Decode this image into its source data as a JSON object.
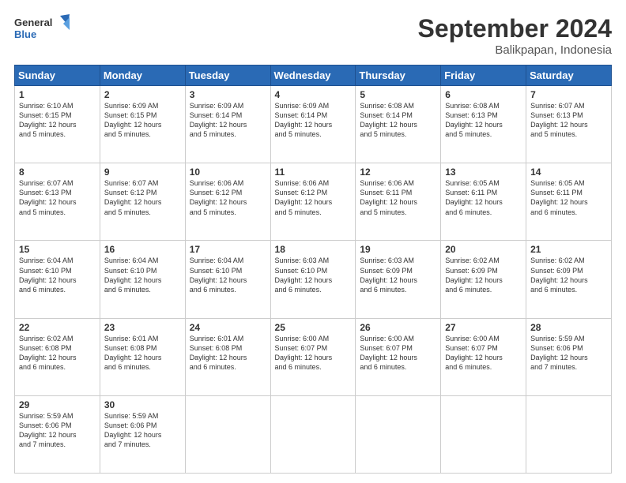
{
  "logo": {
    "line1": "General",
    "line2": "Blue"
  },
  "title": "September 2024",
  "subtitle": "Balikpapan, Indonesia",
  "days_of_week": [
    "Sunday",
    "Monday",
    "Tuesday",
    "Wednesday",
    "Thursday",
    "Friday",
    "Saturday"
  ],
  "weeks": [
    [
      {
        "date": "1",
        "info": "Sunrise: 6:10 AM\nSunset: 6:15 PM\nDaylight: 12 hours\nand 5 minutes."
      },
      {
        "date": "2",
        "info": "Sunrise: 6:09 AM\nSunset: 6:15 PM\nDaylight: 12 hours\nand 5 minutes."
      },
      {
        "date": "3",
        "info": "Sunrise: 6:09 AM\nSunset: 6:14 PM\nDaylight: 12 hours\nand 5 minutes."
      },
      {
        "date": "4",
        "info": "Sunrise: 6:09 AM\nSunset: 6:14 PM\nDaylight: 12 hours\nand 5 minutes."
      },
      {
        "date": "5",
        "info": "Sunrise: 6:08 AM\nSunset: 6:14 PM\nDaylight: 12 hours\nand 5 minutes."
      },
      {
        "date": "6",
        "info": "Sunrise: 6:08 AM\nSunset: 6:13 PM\nDaylight: 12 hours\nand 5 minutes."
      },
      {
        "date": "7",
        "info": "Sunrise: 6:07 AM\nSunset: 6:13 PM\nDaylight: 12 hours\nand 5 minutes."
      }
    ],
    [
      {
        "date": "8",
        "info": "Sunrise: 6:07 AM\nSunset: 6:13 PM\nDaylight: 12 hours\nand 5 minutes."
      },
      {
        "date": "9",
        "info": "Sunrise: 6:07 AM\nSunset: 6:12 PM\nDaylight: 12 hours\nand 5 minutes."
      },
      {
        "date": "10",
        "info": "Sunrise: 6:06 AM\nSunset: 6:12 PM\nDaylight: 12 hours\nand 5 minutes."
      },
      {
        "date": "11",
        "info": "Sunrise: 6:06 AM\nSunset: 6:12 PM\nDaylight: 12 hours\nand 5 minutes."
      },
      {
        "date": "12",
        "info": "Sunrise: 6:06 AM\nSunset: 6:11 PM\nDaylight: 12 hours\nand 5 minutes."
      },
      {
        "date": "13",
        "info": "Sunrise: 6:05 AM\nSunset: 6:11 PM\nDaylight: 12 hours\nand 6 minutes."
      },
      {
        "date": "14",
        "info": "Sunrise: 6:05 AM\nSunset: 6:11 PM\nDaylight: 12 hours\nand 6 minutes."
      }
    ],
    [
      {
        "date": "15",
        "info": "Sunrise: 6:04 AM\nSunset: 6:10 PM\nDaylight: 12 hours\nand 6 minutes."
      },
      {
        "date": "16",
        "info": "Sunrise: 6:04 AM\nSunset: 6:10 PM\nDaylight: 12 hours\nand 6 minutes."
      },
      {
        "date": "17",
        "info": "Sunrise: 6:04 AM\nSunset: 6:10 PM\nDaylight: 12 hours\nand 6 minutes."
      },
      {
        "date": "18",
        "info": "Sunrise: 6:03 AM\nSunset: 6:10 PM\nDaylight: 12 hours\nand 6 minutes."
      },
      {
        "date": "19",
        "info": "Sunrise: 6:03 AM\nSunset: 6:09 PM\nDaylight: 12 hours\nand 6 minutes."
      },
      {
        "date": "20",
        "info": "Sunrise: 6:02 AM\nSunset: 6:09 PM\nDaylight: 12 hours\nand 6 minutes."
      },
      {
        "date": "21",
        "info": "Sunrise: 6:02 AM\nSunset: 6:09 PM\nDaylight: 12 hours\nand 6 minutes."
      }
    ],
    [
      {
        "date": "22",
        "info": "Sunrise: 6:02 AM\nSunset: 6:08 PM\nDaylight: 12 hours\nand 6 minutes."
      },
      {
        "date": "23",
        "info": "Sunrise: 6:01 AM\nSunset: 6:08 PM\nDaylight: 12 hours\nand 6 minutes."
      },
      {
        "date": "24",
        "info": "Sunrise: 6:01 AM\nSunset: 6:08 PM\nDaylight: 12 hours\nand 6 minutes."
      },
      {
        "date": "25",
        "info": "Sunrise: 6:00 AM\nSunset: 6:07 PM\nDaylight: 12 hours\nand 6 minutes."
      },
      {
        "date": "26",
        "info": "Sunrise: 6:00 AM\nSunset: 6:07 PM\nDaylight: 12 hours\nand 6 minutes."
      },
      {
        "date": "27",
        "info": "Sunrise: 6:00 AM\nSunset: 6:07 PM\nDaylight: 12 hours\nand 6 minutes."
      },
      {
        "date": "28",
        "info": "Sunrise: 5:59 AM\nSunset: 6:06 PM\nDaylight: 12 hours\nand 7 minutes."
      }
    ],
    [
      {
        "date": "29",
        "info": "Sunrise: 5:59 AM\nSunset: 6:06 PM\nDaylight: 12 hours\nand 7 minutes."
      },
      {
        "date": "30",
        "info": "Sunrise: 5:59 AM\nSunset: 6:06 PM\nDaylight: 12 hours\nand 7 minutes."
      },
      {
        "date": "",
        "info": ""
      },
      {
        "date": "",
        "info": ""
      },
      {
        "date": "",
        "info": ""
      },
      {
        "date": "",
        "info": ""
      },
      {
        "date": "",
        "info": ""
      }
    ]
  ]
}
